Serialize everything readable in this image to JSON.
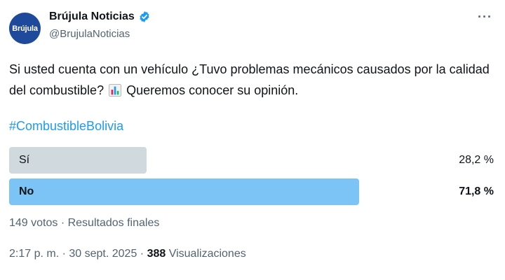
{
  "author": {
    "avatar_text": "Brújula",
    "display_name": "Brújula Noticias",
    "handle": "@BrujulaNoticias",
    "verified_color": "#1d9bf0"
  },
  "tweet": {
    "text_before_emoji": "Si usted cuenta con un vehículo ¿Tuvo problemas mecánicos causados por la calidad del combustible?",
    "emoji": "bar-chart-emoji",
    "text_after_emoji": "Queremos conocer su opinión.",
    "hashtag": "#CombustibleBolivia"
  },
  "poll": {
    "options": [
      {
        "label": "Sí",
        "percent_text": "28,2 %",
        "fraction": 0.282,
        "winner": false
      },
      {
        "label": "No",
        "percent_text": "71,8 %",
        "fraction": 0.718,
        "winner": true
      }
    ],
    "votes_summary": "149 votos · Resultados finales",
    "colors": {
      "winner": "#7cc4f5",
      "other": "#cfd9de"
    }
  },
  "timestamp": {
    "time_date": "2:17 p. m. · 30 sept. 2025 ·",
    "views_count": "388",
    "views_label": "Visualizaciones"
  },
  "menu": {
    "more_label": "···"
  }
}
